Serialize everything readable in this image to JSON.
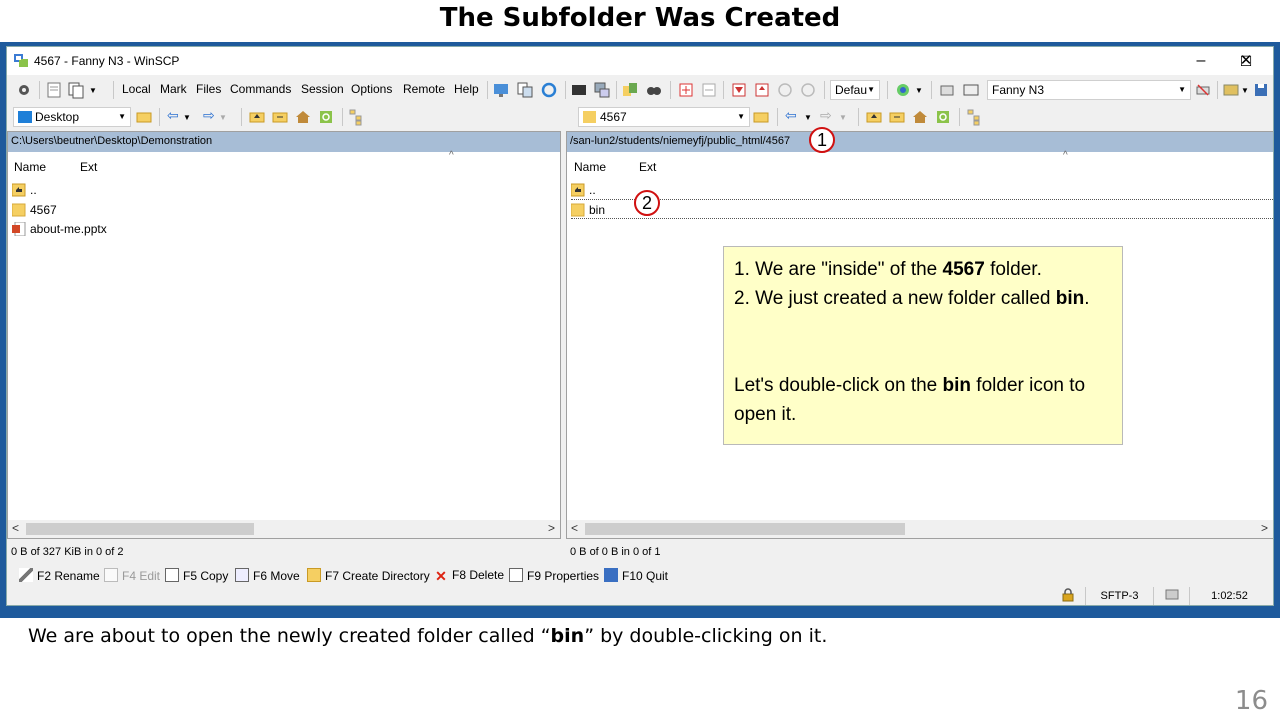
{
  "slide": {
    "title": "The Subfolder Was Created",
    "caption_pre": "We are about to open the newly created folder called “",
    "caption_bold": "bin",
    "caption_post": "” by double-clicking on it.",
    "number": "16"
  },
  "window": {
    "title": "4567 - Fanny N3 - WinSCP",
    "controls": {
      "minimize": "–",
      "maximize": "☐",
      "close": "✕"
    }
  },
  "menu": {
    "items": [
      "Local",
      "Mark",
      "Files",
      "Commands",
      "Session",
      "Options",
      "Remote",
      "Help"
    ],
    "transfer_combo": "Defau",
    "session_combo": "Fanny N3"
  },
  "left_panel": {
    "location_combo": "Desktop",
    "path": "C:\\Users\\beutner\\Desktop\\Demonstration",
    "columns": [
      "Name",
      "Ext"
    ],
    "rows": [
      {
        "name": "..",
        "icon": "parent-folder-icon"
      },
      {
        "name": "4567",
        "icon": "folder-icon"
      },
      {
        "name": "about-me.pptx",
        "icon": "pptx-file-icon"
      }
    ],
    "status": "0 B of 327 KiB in 0 of 2"
  },
  "right_panel": {
    "location_combo": "4567",
    "path": "/san-lun2/students/niemeyfj/public_html/4567",
    "columns": [
      "Name",
      "Ext"
    ],
    "rows": [
      {
        "name": "..",
        "icon": "parent-folder-icon"
      },
      {
        "name": "bin",
        "icon": "folder-icon"
      }
    ],
    "status": "0 B of 0 B in 0 of 1"
  },
  "function_keys": [
    {
      "label": "F2 Rename",
      "enabled": true
    },
    {
      "label": "F4 Edit",
      "enabled": false
    },
    {
      "label": "F5 Copy",
      "enabled": true
    },
    {
      "label": "F6 Move",
      "enabled": true
    },
    {
      "label": "F7 Create Directory",
      "enabled": true
    },
    {
      "label": "F8 Delete",
      "enabled": true
    },
    {
      "label": "F9 Properties",
      "enabled": true
    },
    {
      "label": "F10 Quit",
      "enabled": true
    }
  ],
  "status_bar": {
    "protocol": "SFTP-3",
    "elapsed": "1:02:52"
  },
  "callout": {
    "line1_pre": "1. We are \"inside\" of the ",
    "line1_bold": "4567",
    "line1_post": " folder.",
    "line2_pre": "2. We just created a new folder called ",
    "line2_bold": "bin",
    "line2_post": ".",
    "line3_pre": "Let's double-click on the ",
    "line3_bold": "bin",
    "line3_post": " folder icon to open it."
  },
  "badges": [
    "1",
    "2"
  ],
  "colors": {
    "frame_blue": "#1e5a9c",
    "path_bar": "#a7bdd6",
    "callout_bg": "#ffffc8",
    "badge_ring": "#d01010"
  }
}
